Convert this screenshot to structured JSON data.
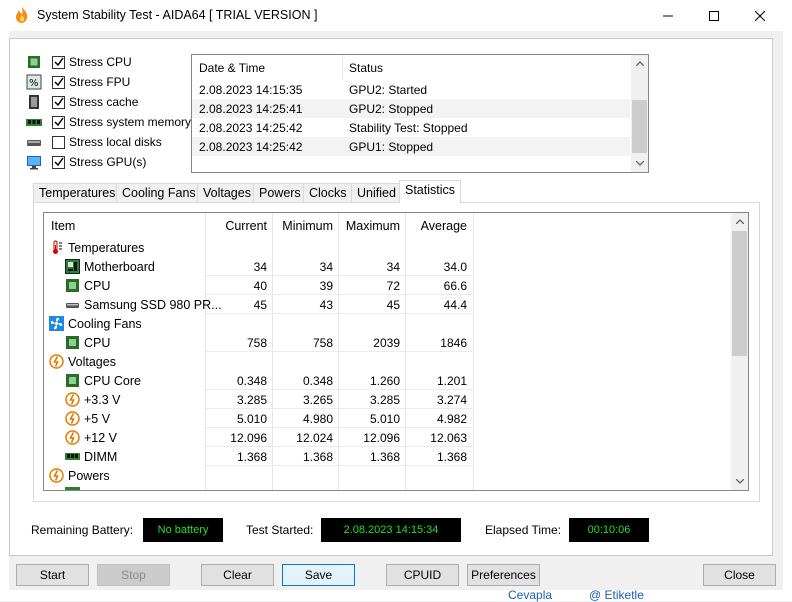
{
  "window": {
    "title": "System Stability Test - AIDA64  [ TRIAL VERSION ]"
  },
  "stress": [
    {
      "label": "Stress CPU",
      "checked": true,
      "icon": "cpu-icon"
    },
    {
      "label": "Stress FPU",
      "checked": true,
      "icon": "fpu-icon"
    },
    {
      "label": "Stress cache",
      "checked": true,
      "icon": "cache-icon"
    },
    {
      "label": "Stress system memory",
      "checked": true,
      "icon": "memory-icon"
    },
    {
      "label": "Stress local disks",
      "checked": false,
      "icon": "disk-icon"
    },
    {
      "label": "Stress GPU(s)",
      "checked": true,
      "icon": "monitor-icon"
    }
  ],
  "log": {
    "headers": {
      "datetime": "Date & Time",
      "status": "Status"
    },
    "rows": [
      {
        "datetime": "2.08.2023 14:15:35",
        "status": "GPU2: Started"
      },
      {
        "datetime": "2.08.2023 14:25:41",
        "status": "GPU2: Stopped"
      },
      {
        "datetime": "2.08.2023 14:25:42",
        "status": "Stability Test: Stopped"
      },
      {
        "datetime": "2.08.2023 14:25:42",
        "status": "GPU1: Stopped"
      }
    ]
  },
  "tabs": [
    "Temperatures",
    "Cooling Fans",
    "Voltages",
    "Powers",
    "Clocks",
    "Unified",
    "Statistics"
  ],
  "active_tab": "Statistics",
  "stats": {
    "headers": {
      "item": "Item",
      "current": "Current",
      "minimum": "Minimum",
      "maximum": "Maximum",
      "average": "Average"
    },
    "rows": [
      {
        "type": "group",
        "name": "Temperatures",
        "icon": "thermometer-icon"
      },
      {
        "type": "item",
        "name": "Motherboard",
        "icon": "motherboard-icon",
        "current": "34",
        "minimum": "34",
        "maximum": "34",
        "average": "34.0"
      },
      {
        "type": "item",
        "name": "CPU",
        "icon": "cpu-icon",
        "current": "40",
        "minimum": "39",
        "maximum": "72",
        "average": "66.6"
      },
      {
        "type": "item",
        "name": "Samsung SSD 980 PR...",
        "icon": "ssd-icon",
        "current": "45",
        "minimum": "43",
        "maximum": "45",
        "average": "44.4"
      },
      {
        "type": "group",
        "name": "Cooling Fans",
        "icon": "fan-icon"
      },
      {
        "type": "item",
        "name": "CPU",
        "icon": "cpu-icon",
        "current": "758",
        "minimum": "758",
        "maximum": "2039",
        "average": "1846"
      },
      {
        "type": "group",
        "name": "Voltages",
        "icon": "voltage-icon"
      },
      {
        "type": "item",
        "name": "CPU Core",
        "icon": "cpu-icon",
        "current": "0.348",
        "minimum": "0.348",
        "maximum": "1.260",
        "average": "1.201"
      },
      {
        "type": "item",
        "name": "+3.3 V",
        "icon": "voltage-icon",
        "current": "3.285",
        "minimum": "3.265",
        "maximum": "3.285",
        "average": "3.274"
      },
      {
        "type": "item",
        "name": "+5 V",
        "icon": "voltage-icon",
        "current": "5.010",
        "minimum": "4.980",
        "maximum": "5.010",
        "average": "4.982"
      },
      {
        "type": "item",
        "name": "+12 V",
        "icon": "voltage-icon",
        "current": "12.096",
        "minimum": "12.024",
        "maximum": "12.096",
        "average": "12.063"
      },
      {
        "type": "item",
        "name": "DIMM",
        "icon": "memory-icon",
        "current": "1.368",
        "minimum": "1.368",
        "maximum": "1.368",
        "average": "1.368"
      },
      {
        "type": "group",
        "name": "Powers",
        "icon": "power-icon"
      }
    ]
  },
  "status_bar": {
    "battery_label": "Remaining Battery:",
    "battery_value": "No battery",
    "started_label": "Test Started:",
    "started_value": "2.08.2023 14:15:34",
    "elapsed_label": "Elapsed Time:",
    "elapsed_value": "00:10:06"
  },
  "buttons": {
    "start": "Start",
    "stop": "Stop",
    "clear": "Clear",
    "save": "Save",
    "cpuid": "CPUID",
    "preferences": "Preferences",
    "close": "Close"
  },
  "background": {
    "link1": "Cevapla",
    "link2": "@ Etiketle"
  },
  "colors": {
    "lcd_text": "#20e020",
    "accent": "#0078d7"
  }
}
